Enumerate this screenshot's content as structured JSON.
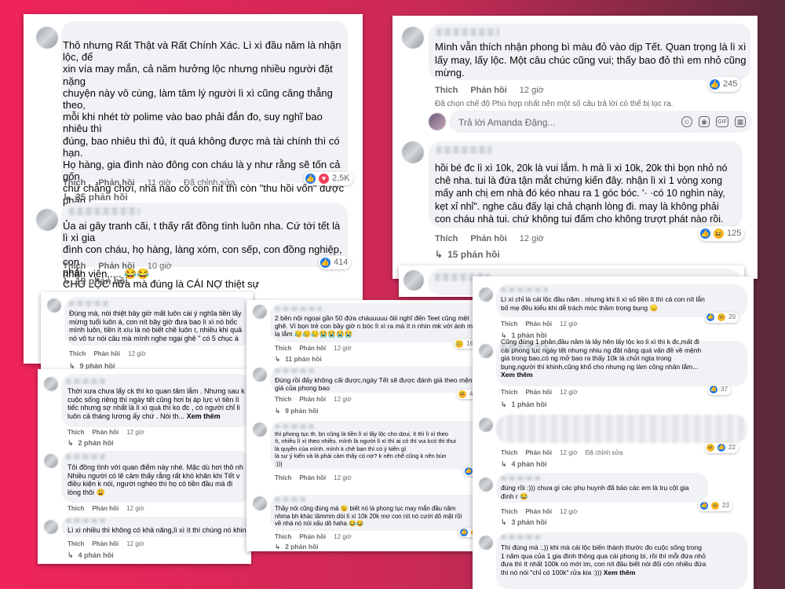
{
  "common": {
    "like": "Thích",
    "reply": "Phản hồi",
    "edited": "Đã chỉnh sửa",
    "see_more": "Xem thêm"
  },
  "card1": {
    "c1": {
      "text": "Thô nhưng Rất Thật và Rất Chính Xác. Lì xì đầu năm là nhận lộc, để\nxin vía may mắn, cả năm hưởng lộc nhưng nhiều người đặt nặng\nchuyện này vô cùng, làm tâm lý người lì xì cũng căng thẳng theo,\nmỗi khi nhét tờ polime vào bao phải đắn đo, suy nghĩ bao nhiêu thì\nđúng, bao nhiêu thì đủ, ít quá không được mà tài chính thì có hạn.\nHọ hàng, gia đình nào đông con cháu là y như rằng sẽ tốn cả gốn\nchứ chẳng chơi, nhà nào có con nít thì còn \"thu hồi vốn\" được phần\nnào không thì cũng phải ráng chi một khoản cho cháu nội, cháu\nngoại hai bên. Bởi nhiều người họ sợ Tết là vậy, vì không phải năm\nnào công việc, làm ăn kinh doanh cũng suôn sẻ. Cái đó không phải\nCHO LỘC nữa mà đúng là CÁI NỢ thiệt sự",
      "time": "11 giờ",
      "reactions": "2,5K",
      "replies": "35 phản hồi"
    },
    "c2": {
      "text": "Ủa ai gây tranh cãi, t thấy rất đồng tình luôn nha. Cứ tới tết là lì xì gia\nđình con cháu, họ hàng, làng xóm, con sếp, con đồng nghiệp, con\nnhân viên,.... 😂😂",
      "time": "10 giờ",
      "reactions": "414",
      "replies": "19 phản hồi"
    }
  },
  "card2": {
    "c1": {
      "text": "Mình vẫn thích nhận phong bì màu đỏ vào dịp Tết. Quan trọng là lì xì\nlấy may, lấy lộc. Một câu chúc cũng vui; thấy bao đỏ thì em nhỏ cũng\nmừng.",
      "time": "12 giờ",
      "reactions": "245"
    },
    "note": "Đã chọn chế độ Phù hợp nhất nên một số câu trả lời có thể bị lọc ra.",
    "reply_placeholder": "Trả lời Amanda Đặng...",
    "c2": {
      "text": "hồi bé đc lì xì 10k, 20k là vui lắm. h mà lì xì 10k, 20k thì bọn nhỏ nó\nchê nha. tui là đứa tận mắt chứng kiến đây. nhận lì xì 1 vòng xong\nmấy anh chị em nhà đó kéo nhau ra 1 góc bóc. '·   ·có 10 nghìn này,\nkẹt xỉ nhỉ\". nghe câu đấy lại chả chạnh lòng đi. may là không phải\ncon cháu nhà tui. chứ không tui đấm cho không trượt phát nào rồi.",
      "time": "12 giờ",
      "reactions": "125",
      "replies": "15 phản hồi"
    }
  },
  "card3": {
    "c1": {
      "text": "Đúng mà, nói thiệt bây giờ mất luôn cái ý nghĩa tiền lấy\nmừng tuổi luôn á, con nít bây giờ đưa bao lì xì nó bốc\nmình luôn, tiền ít xíu là nó biết chê luôn r, nhiều khi quả\nnó vô tư nói câu mà mình nghe ngại ghê \" có 5 chục à",
      "time": "12 giờ",
      "replies": "9 phản hồi"
    }
  },
  "card4": {
    "c1": {
      "text": "Thời xưa chưa lấy ck thì ko quan tâm lắm . Nhưng sau k\ncuộc sống riêng thì ngày tết cũng hơi bị áp lực vì tiền lì\ntiếc nhưng sợ nhất là lì xì quá thì ko đc , có người chỉ lì\nluôn cả tháng lương ấy chứ . Nói th...",
      "time": "12 giờ",
      "replies": "2 phản hồi"
    },
    "c2": {
      "text": "Tôi đồng tình với quan điểm này nhé. Mặc dù hơi thô nh\nNhiều người có lẽ cảm thấy rằng rất khó khăn khi Tết v\nđiều kiện k nói, người nghèo thì họ có tiền đầu mà đi\nlòng thôi 😩",
      "time": "12 giờ"
    },
    "c3": {
      "text": "Lì xì nhiều thì không có khả năng,lì xì ít thì chúng nó khinh",
      "time": "12 giờ",
      "replies": "4 phản hồi"
    }
  },
  "card5": {
    "c1": {
      "text": "2 bên nội ngoại gần 50 đứa cháuuuuu ôiii nghĩ đến Teet cũng mệt\nghê. Vì bọn trẻ con bây giờ n bóc lì xì ra mà ít n nhìn mk với ánh mắt\nlạ lắm 😥😥😥😭😭😭😭",
      "time": "12 giờ",
      "reactions": "16",
      "replies": "11 phản hồi"
    },
    "c2": {
      "text": "Đúng rồi đấy không cãi được,ngày Tết sẽ được đánh giá theo mệnh\ngiá của phong bao",
      "time": "12 giờ",
      "reactions": "4",
      "replies": "9 phản hồi"
    },
    "c3": {
      "text": "thì phong tục th. bn cũng là tiền lì xì lấy lộc cho dzui, ít thì lì xì theo\nít, nhiều lì xì theo nhiều. mình là người lì xì thì ai có thì vui kcó thì thui\nlà quyền của mình. mình k chê bạn thì có ý kiến gì\nlà sự ý kiến và là phải cảm thấy có nợ? k nên chê cũng k nên bùn\n:)))",
      "time": "12 giờ",
      "reactions": "5"
    },
    "c4": {
      "text": "Thầy nói cũng đúng mà 😉 biết nó là phong tục may mắn đầu năm\nnhma bh khác lămmm dòi lì xì 10k 20k mơ con nít nó cười dô mặt rồi\nvề nhà nó nói xấu dô haha 😂😂",
      "time": "12 giờ",
      "reactions": "12",
      "replies": "2 phản hồi"
    }
  },
  "card6": {
    "c1": {
      "text": "Lì xì chỉ là cái lộc đầu năm . nhưng khi lì xì số tiền ít thì cả con nít lẫn\nbố mẹ đều kiểu khi dễ trách móc thầm trong bụng 😞",
      "time": "12 giờ",
      "reactions": "20",
      "replies": "1 phản hồi"
    },
    "c2": {
      "text": "Cũng đúng 1 phần,đầu năm là lấy hên lấy lộc ko lì xì thì k đc,mất đi\ncái phong tục ngày tết nhưng nhiu ng đặt nặng quá vấn đề về mệnh\ngiá trong bao,có ng mở bao ra thấy 10k là chửi ngta trong\nbụng,người thì khinh,cũng khổ cho nhưng ng làm công nhân lắm...",
      "time": "12 giờ",
      "reactions": "37",
      "replies": "1 phản hồi"
    },
    "c3": {
      "time": "12 giờ",
      "reactions": "22",
      "replies": "4 phản hồi"
    },
    "c4": {
      "text": "đúng rồi :))) chưa gì các phụ huynh đã bảo các em là trụ cột gia\nđình r 😂",
      "time": "12 giờ",
      "reactions": "23",
      "replies": "3 phản hồi"
    },
    "c5": {
      "text": "Thì đúng mà :,)) khi mà cái lộc biến thành thước đo cuộc sống trong\n1 năm qua của 1 gia đình thông qua cái phong bì, rồi thì mỗi đứa nhỏ\nđưa thì ít nhất 100k nó mới ìm, con nít đâu biết nói đối còn nhiều đứa\nthì nó nói \"chỉ có 100k\" rửa kia :)))"
    }
  }
}
